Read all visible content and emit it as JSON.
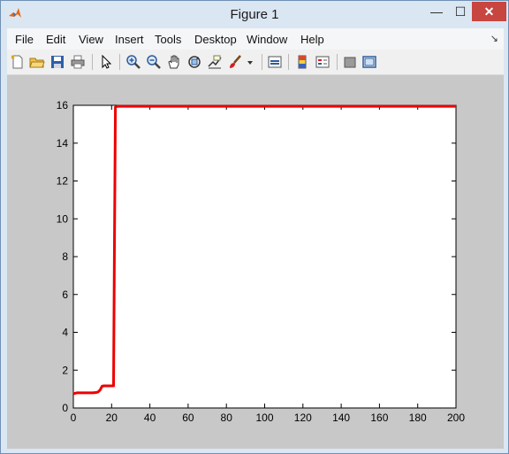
{
  "window": {
    "title": "Figure 1"
  },
  "title_controls": {
    "minimize": "—",
    "maximize": "☐",
    "close": "✕"
  },
  "menu": {
    "items": [
      "File",
      "Edit",
      "View",
      "Insert",
      "Tools",
      "Desktop",
      "Window",
      "Help"
    ],
    "dock_arrow": "↘"
  },
  "toolbar": {
    "icons": [
      "new-figure-icon",
      "open-file-icon",
      "save-icon",
      "print-icon",
      "pointer-icon",
      "zoom-in-icon",
      "zoom-out-icon",
      "pan-icon",
      "rotate-3d-icon",
      "data-cursor-icon",
      "brush-icon",
      "brush-dropdown-icon",
      "link-plot-icon",
      "colorbar-icon",
      "legend-icon",
      "hide-plot-tools-icon",
      "show-plot-tools-icon"
    ]
  },
  "colors": {
    "line": "#ee0000",
    "figure_bg": "#c8c8c8",
    "axes_bg": "#ffffff",
    "close_button": "#c7463f"
  },
  "chart_data": {
    "type": "line",
    "title": "",
    "xlabel": "",
    "ylabel": "",
    "xlim": [
      0,
      200
    ],
    "ylim": [
      0,
      16
    ],
    "xticks": [
      0,
      20,
      40,
      60,
      80,
      100,
      120,
      140,
      160,
      180,
      200
    ],
    "yticks": [
      0,
      2,
      4,
      6,
      8,
      10,
      12,
      14,
      16
    ],
    "xtick_labels": [
      "0",
      "20",
      "40",
      "60",
      "80",
      "100",
      "120",
      "140",
      "160",
      "180",
      "200"
    ],
    "ytick_labels": [
      "0",
      "2",
      "4",
      "6",
      "8",
      "10",
      "12",
      "14",
      "16"
    ],
    "grid": false,
    "series": [
      {
        "color": "#ee0000",
        "x": [
          0,
          1,
          2,
          3,
          5,
          8,
          10,
          12,
          13,
          14,
          15,
          16,
          17,
          18,
          19,
          20,
          21,
          21.5,
          22,
          23,
          24,
          40,
          60,
          80,
          100,
          120,
          140,
          160,
          180,
          200
        ],
        "y": [
          0.75,
          0.78,
          0.8,
          0.8,
          0.8,
          0.8,
          0.8,
          0.82,
          0.85,
          0.95,
          1.15,
          1.17,
          1.17,
          1.17,
          1.17,
          1.17,
          1.17,
          8.5,
          15.9,
          15.95,
          15.95,
          15.95,
          15.95,
          15.95,
          15.95,
          15.95,
          15.95,
          15.95,
          15.95,
          15.95
        ]
      }
    ]
  }
}
